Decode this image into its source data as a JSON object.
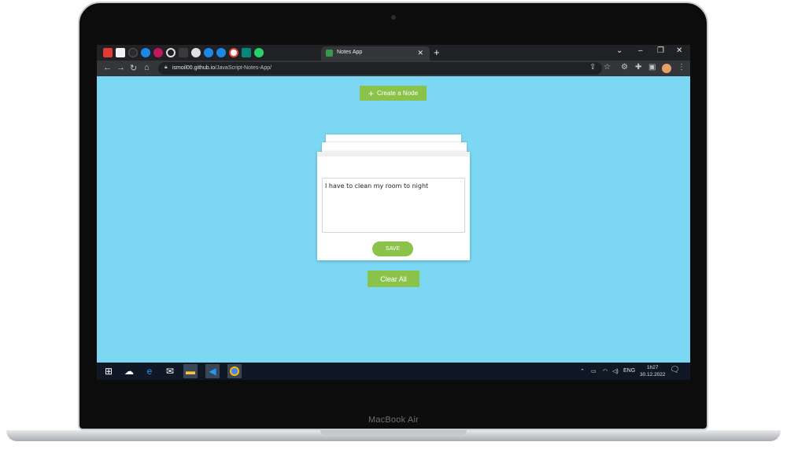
{
  "device": {
    "model_label": "MacBook Air"
  },
  "browser": {
    "tab_title": "Notes App",
    "new_tab_symbol": "+",
    "tab_close_symbol": "✕",
    "url_host": "ismoil00.github.io",
    "url_path": "/JavaScript-Notes-App/",
    "window_controls": [
      "⌄",
      "–",
      "❐",
      "✕"
    ],
    "pinned_tabs": [
      "youtube-icon",
      "medium-icon",
      "github-icon",
      "edge-icon",
      "dribbble-icon",
      "circle-icon",
      "notion-icon",
      "globe-icon",
      "edge-icon",
      "edge-icon",
      "google-icon",
      "meet-icon",
      "whatsapp-icon"
    ]
  },
  "app": {
    "create_label": "Create a Node",
    "note_text": "I have to clean my room to night",
    "save_label": "SAVE",
    "clear_label": "Clear All",
    "accent_color": "#8bc34a",
    "background_color": "#7cd8f2"
  },
  "taskbar": {
    "language": "ENG",
    "time": "1h27",
    "date": "30.12.2022"
  }
}
